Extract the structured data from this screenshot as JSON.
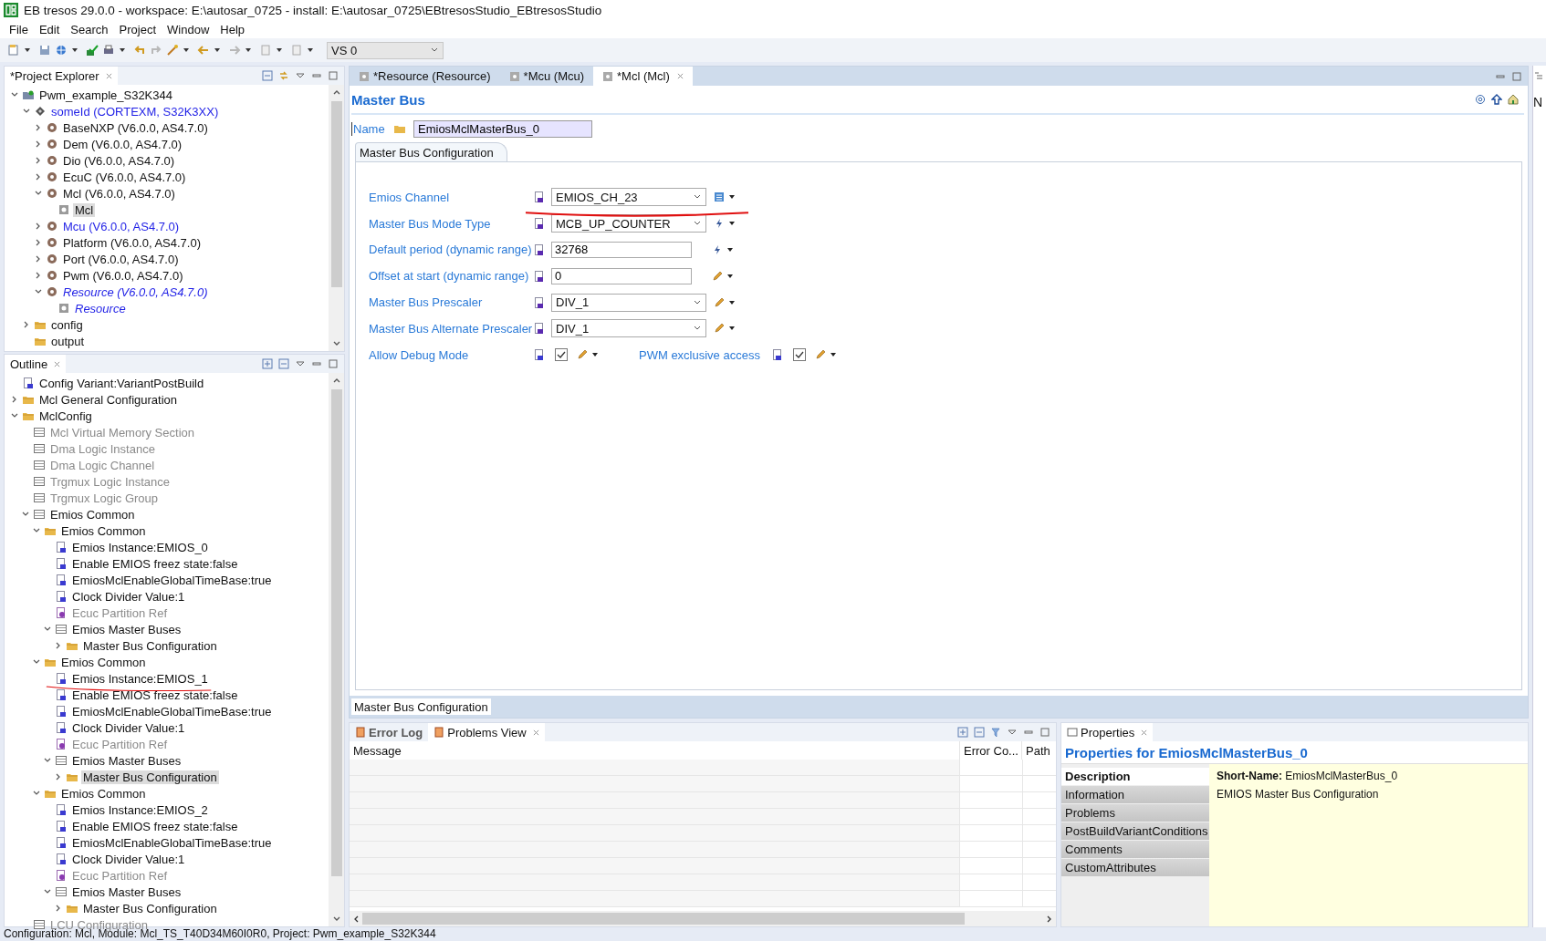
{
  "window": {
    "title": "EB tresos 29.0.0 - workspace: E:\\autosar_0725 - install: E:\\autosar_0725\\EBtresosStudio_EBtresosStudio"
  },
  "menu": [
    "File",
    "Edit",
    "Search",
    "Project",
    "Window",
    "Help"
  ],
  "toolbar": {
    "variant": "VS 0"
  },
  "explorer": {
    "title": "*Project Explorer",
    "items": [
      {
        "label": "Pwm_example_S32K344",
        "kind": "project",
        "expanded": true,
        "selected": false,
        "children": [
          {
            "label": "someId (CORTEXM, S32K3XX)",
            "kind": "chip",
            "expanded": true,
            "selected": false,
            "color": "#1f1fe6",
            "children": [
              {
                "label": "BaseNXP (V6.0.0, AS4.7.0)",
                "kind": "module",
                "expanded": false,
                "selected": false
              },
              {
                "label": "Dem (V6.0.0, AS4.7.0)",
                "kind": "module",
                "expanded": false,
                "selected": false
              },
              {
                "label": "Dio (V6.0.0, AS4.7.0)",
                "kind": "module",
                "expanded": false,
                "selected": false
              },
              {
                "label": "EcuC (V6.0.0, AS4.7.0)",
                "kind": "module",
                "expanded": false,
                "selected": false
              },
              {
                "label": "Mcl (V6.0.0, AS4.7.0)",
                "kind": "module",
                "expanded": true,
                "selected": false,
                "children": [
                  {
                    "label": "Mcl",
                    "kind": "config",
                    "selected": true
                  }
                ]
              },
              {
                "label": "Mcu (V6.0.0, AS4.7.0)",
                "kind": "module",
                "expanded": false,
                "selected": false,
                "color": "#1f1fe6"
              },
              {
                "label": "Platform (V6.0.0, AS4.7.0)",
                "kind": "module",
                "expanded": false,
                "selected": false
              },
              {
                "label": "Port (V6.0.0, AS4.7.0)",
                "kind": "module",
                "expanded": false,
                "selected": false
              },
              {
                "label": "Pwm (V6.0.0, AS4.7.0)",
                "kind": "module",
                "expanded": false,
                "selected": false
              },
              {
                "label": "Resource (V6.0.0, AS4.7.0)",
                "kind": "module",
                "expanded": true,
                "selected": false,
                "color": "#1f1fe6",
                "italic": true,
                "children": [
                  {
                    "label": "Resource",
                    "kind": "config",
                    "selected": false,
                    "color": "#1f1fe6",
                    "italic": true
                  }
                ]
              }
            ]
          },
          {
            "label": "config",
            "kind": "folder",
            "expanded": false,
            "selected": false
          },
          {
            "label": "output",
            "kind": "folder",
            "selected": false
          }
        ]
      }
    ]
  },
  "outline": {
    "title": "Outline",
    "items": [
      {
        "label": "Config Variant:VariantPostBuild",
        "kind": "param",
        "selected": false
      },
      {
        "label": "Mcl General Configuration",
        "kind": "folder",
        "expanded": false,
        "selected": false
      },
      {
        "label": "MclConfig",
        "kind": "folder",
        "expanded": true,
        "selected": false,
        "children": [
          {
            "label": "Mcl Virtual Memory Section",
            "kind": "table",
            "selected": false,
            "disabled": true
          },
          {
            "label": "Dma Logic Instance",
            "kind": "table",
            "selected": false,
            "disabled": true
          },
          {
            "label": "Dma Logic Channel",
            "kind": "table",
            "selected": false,
            "disabled": true
          },
          {
            "label": "Trgmux Logic Instance",
            "kind": "table",
            "selected": false,
            "disabled": true
          },
          {
            "label": "Trgmux Logic Group",
            "kind": "table",
            "selected": false,
            "disabled": true
          },
          {
            "label": "Emios Common",
            "kind": "table",
            "expanded": true,
            "selected": false,
            "disabled": false,
            "children": [
              {
                "label": "Emios Common",
                "kind": "folder",
                "expanded": true,
                "selected": false,
                "children": [
                  {
                    "label": "Emios Instance:EMIOS_0",
                    "kind": "param",
                    "selected": false,
                    "disabled": false
                  },
                  {
                    "label": "Enable EMIOS freez state:false",
                    "kind": "param",
                    "selected": false,
                    "disabled": false
                  },
                  {
                    "label": "EmiosMclEnableGlobalTimeBase:true",
                    "kind": "param",
                    "selected": false,
                    "disabled": false
                  },
                  {
                    "label": "Clock Divider Value:1",
                    "kind": "param",
                    "selected": false,
                    "disabled": false
                  },
                  {
                    "label": "Ecuc Partition Ref",
                    "kind": "ref",
                    "selected": false,
                    "disabled": true
                  },
                  {
                    "label": "Emios Master Buses",
                    "kind": "table",
                    "expanded": true,
                    "selected": false,
                    "disabled": false,
                    "children": [
                      {
                        "label": "Master Bus Configuration",
                        "kind": "folder",
                        "expanded": false,
                        "selected": false
                      }
                    ]
                  }
                ]
              },
              {
                "label": "Emios Common",
                "kind": "folder",
                "expanded": true,
                "selected": false,
                "children": [
                  {
                    "label": "Emios Instance:EMIOS_1",
                    "kind": "param",
                    "selected": false,
                    "disabled": false
                  },
                  {
                    "label": "Enable EMIOS freez state:false",
                    "kind": "param",
                    "selected": false,
                    "disabled": false
                  },
                  {
                    "label": "EmiosMclEnableGlobalTimeBase:true",
                    "kind": "param",
                    "selected": false,
                    "disabled": false
                  },
                  {
                    "label": "Clock Divider Value:1",
                    "kind": "param",
                    "selected": false,
                    "disabled": false
                  },
                  {
                    "label": "Ecuc Partition Ref",
                    "kind": "ref",
                    "selected": false,
                    "disabled": true
                  },
                  {
                    "label": "Emios Master Buses",
                    "kind": "table",
                    "expanded": true,
                    "selected": false,
                    "disabled": false,
                    "children": [
                      {
                        "label": "Master Bus Configuration",
                        "kind": "folder",
                        "expanded": false,
                        "selected": true
                      }
                    ]
                  }
                ]
              },
              {
                "label": "Emios Common",
                "kind": "folder",
                "expanded": true,
                "selected": false,
                "children": [
                  {
                    "label": "Emios Instance:EMIOS_2",
                    "kind": "param",
                    "selected": false,
                    "disabled": false
                  },
                  {
                    "label": "Enable EMIOS freez state:false",
                    "kind": "param",
                    "selected": false,
                    "disabled": false
                  },
                  {
                    "label": "EmiosMclEnableGlobalTimeBase:true",
                    "kind": "param",
                    "selected": false,
                    "disabled": false
                  },
                  {
                    "label": "Clock Divider Value:1",
                    "kind": "param",
                    "selected": false,
                    "disabled": false
                  },
                  {
                    "label": "Ecuc Partition Ref",
                    "kind": "ref",
                    "selected": false,
                    "disabled": true
                  },
                  {
                    "label": "Emios Master Buses",
                    "kind": "table",
                    "expanded": true,
                    "selected": false,
                    "disabled": false,
                    "children": [
                      {
                        "label": "Master Bus Configuration",
                        "kind": "folder",
                        "expanded": false,
                        "selected": false
                      }
                    ]
                  }
                ]
              }
            ]
          },
          {
            "label": "LCU Configuration",
            "kind": "table",
            "selected": false,
            "disabled": true
          }
        ]
      }
    ]
  },
  "editor_tabs": [
    {
      "label": "*Resource (Resource)",
      "selected": false
    },
    {
      "label": "*Mcu (Mcu)",
      "selected": false
    },
    {
      "label": "*Mcl (Mcl)",
      "selected": true
    }
  ],
  "editor": {
    "heading": "Master Bus",
    "name_label": "Name",
    "name_value": "EmiosMclMasterBus_0",
    "group_title": "Master Bus Configuration",
    "fields": [
      {
        "kind": "combo",
        "label": "Emios Channel",
        "value": "EMIOS_CH_23",
        "tool": {
          "kind": "calculator"
        }
      },
      {
        "kind": "combo",
        "label": "Master Bus Mode Type",
        "value": "MCB_UP_COUNTER",
        "tool": {
          "kind": "lightning"
        }
      },
      {
        "kind": "text",
        "label": "Default period (dynamic range)",
        "value": "32768",
        "tool": {
          "kind": "lightning"
        }
      },
      {
        "kind": "text",
        "label": "Offset at start (dynamic range)",
        "value": "0",
        "tool": {
          "kind": "pencil"
        }
      },
      {
        "kind": "combo",
        "label": "Master Bus Prescaler",
        "value": "DIV_1",
        "tool": {
          "kind": "pencil"
        }
      },
      {
        "kind": "combo",
        "label": "Master Bus Alternate Prescaler",
        "value": "DIV_1",
        "tool": {
          "kind": "pencil"
        }
      },
      {
        "kind": "checks",
        "items": [
          {
            "label": "Allow Debug Mode",
            "checked": true
          },
          {
            "label": "PWM exclusive access",
            "checked": true
          }
        ]
      }
    ],
    "footer_tab": "Master Bus Configuration"
  },
  "bottom_tabs": [
    {
      "label": "Error Log",
      "selected": false
    },
    {
      "label": "Problems View",
      "selected": true
    }
  ],
  "problems": {
    "columns": [
      "Message",
      "Error Co...",
      "Path"
    ]
  },
  "properties": {
    "tab": "Properties",
    "heading": "Properties for EmiosMclMasterBus_0",
    "sections": [
      {
        "label": "Description",
        "selected": true
      },
      {
        "label": "Information",
        "selected": false
      },
      {
        "label": "Problems",
        "selected": false
      },
      {
        "label": "PostBuildVariantConditions",
        "selected": false
      },
      {
        "label": "Comments",
        "selected": false
      },
      {
        "label": "CustomAttributes",
        "selected": false
      }
    ],
    "short_name_label": "Short-Name:",
    "short_name": "EmiosMclMasterBus_0",
    "description": "EMIOS Master Bus Configuration"
  },
  "right_strip": {
    "title": "N"
  },
  "status_bar": "Configuration: Mcl, Module: Mcl_TS_T40D34M60I0R0, Project: Pwm_example_S32K344"
}
